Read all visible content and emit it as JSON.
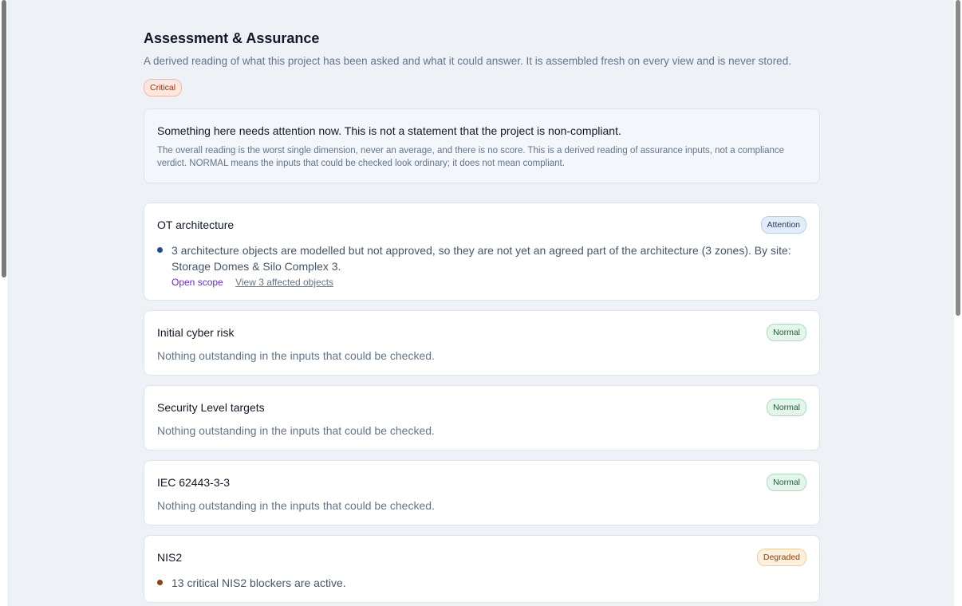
{
  "page": {
    "title": "Assessment & Assurance",
    "subtitle": "A derived reading of what this project has been asked and what it could answer. It is assembled fresh on every view and is never stored.",
    "overall_status": "Critical"
  },
  "summary": {
    "headline": "Something here needs attention now. This is not a statement that the project is non-compliant.",
    "note": "The overall reading is the worst single dimension, never an average, and there is no score. This is a derived reading of assurance inputs, not a compliance verdict. NORMAL means the inputs that could be checked look ordinary; it does not mean compliant."
  },
  "dimensions": [
    {
      "title": "OT architecture",
      "status": "Attention",
      "status_color": "#1e3a5f",
      "finding": "3 architecture objects are modelled but not approved, so they are not yet an agreed part of the architecture (3 zones). By site: Storage Domes & Silo Complex 3.",
      "links": {
        "scope": "Open scope",
        "objects": "View 3 affected objects"
      }
    },
    {
      "title": "Initial cyber risk",
      "status": "Normal",
      "status_color": "#166534",
      "text": "Nothing outstanding in the inputs that could be checked."
    },
    {
      "title": "Security Level targets",
      "status": "Normal",
      "status_color": "#166534",
      "text": "Nothing outstanding in the inputs that could be checked."
    },
    {
      "title": "IEC 62443-3-3",
      "status": "Normal",
      "status_color": "#166534",
      "text": "Nothing outstanding in the inputs that could be checked."
    },
    {
      "title": "NIS2",
      "status": "Degraded",
      "status_color": "#92400e",
      "finding": "13 critical NIS2 blockers are active."
    }
  ]
}
